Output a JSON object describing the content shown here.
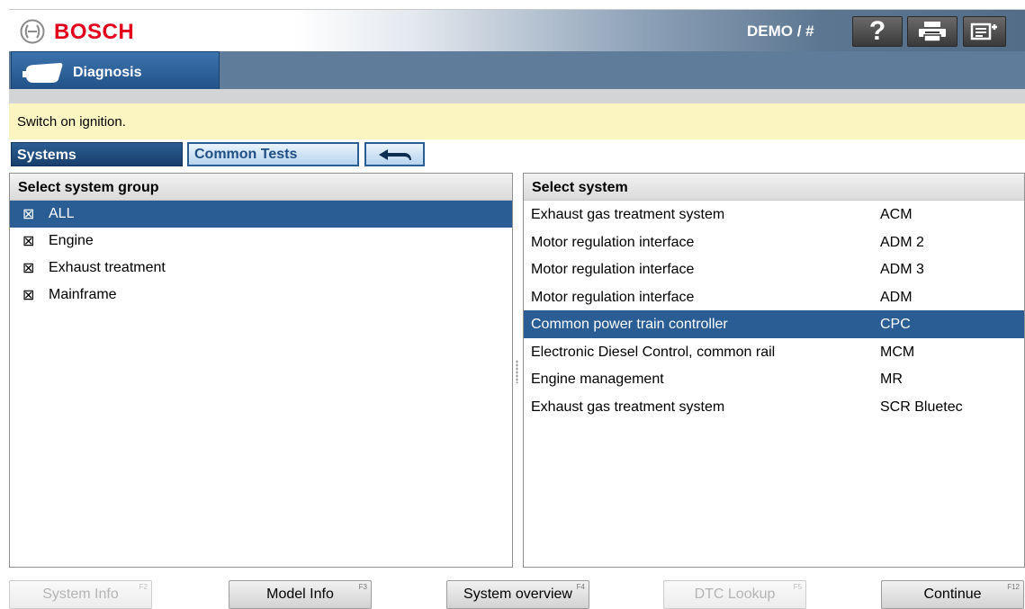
{
  "header": {
    "brand": "BOSCH",
    "demo": "DEMO / #",
    "help_label": "?",
    "icons": [
      "bosch-logo-icon",
      "help-icon",
      "print-icon",
      "menu-exit-icon"
    ]
  },
  "nav": {
    "diagnosis_label": "Diagnosis",
    "icon": "obd-plug-icon"
  },
  "message": "Switch on ignition.",
  "tabs": {
    "systems": "Systems",
    "common_tests": "Common Tests",
    "back_icon": "back-arrow-icon"
  },
  "left_panel": {
    "title": "Select system group",
    "check_glyph": "⊠",
    "items": [
      {
        "label": "ALL",
        "selected": true
      },
      {
        "label": "Engine",
        "selected": false
      },
      {
        "label": "Exhaust treatment",
        "selected": false
      },
      {
        "label": "Mainframe",
        "selected": false
      }
    ]
  },
  "right_panel": {
    "title": "Select system",
    "items": [
      {
        "name": "Exhaust gas treatment system",
        "code": "ACM",
        "selected": false
      },
      {
        "name": "Motor regulation interface",
        "code": "ADM 2",
        "selected": false
      },
      {
        "name": "Motor regulation interface",
        "code": "ADM 3",
        "selected": false
      },
      {
        "name": "Motor regulation interface",
        "code": "ADM",
        "selected": false
      },
      {
        "name": "Common power train controller",
        "code": "CPC",
        "selected": true
      },
      {
        "name": "Electronic Diesel Control, common rail",
        "code": "MCM",
        "selected": false
      },
      {
        "name": "Engine management",
        "code": "MR",
        "selected": false
      },
      {
        "name": "Exhaust gas treatment system",
        "code": "SCR Bluetec",
        "selected": false
      }
    ]
  },
  "footer": {
    "system_info": {
      "label": "System Info",
      "key": "F2",
      "enabled": false
    },
    "model_info": {
      "label": "Model Info",
      "key": "F3",
      "enabled": true
    },
    "system_overview": {
      "label": "System overview",
      "key": "F4",
      "enabled": true
    },
    "dtc_lookup": {
      "label": "DTC Lookup",
      "key": "F5",
      "enabled": false
    },
    "continue": {
      "label": "Continue",
      "key": "F12",
      "enabled": true
    }
  },
  "colors": {
    "brand_red": "#e2001a",
    "selection_blue": "#2a5d93",
    "message_yellow": "#fbf5c1"
  }
}
